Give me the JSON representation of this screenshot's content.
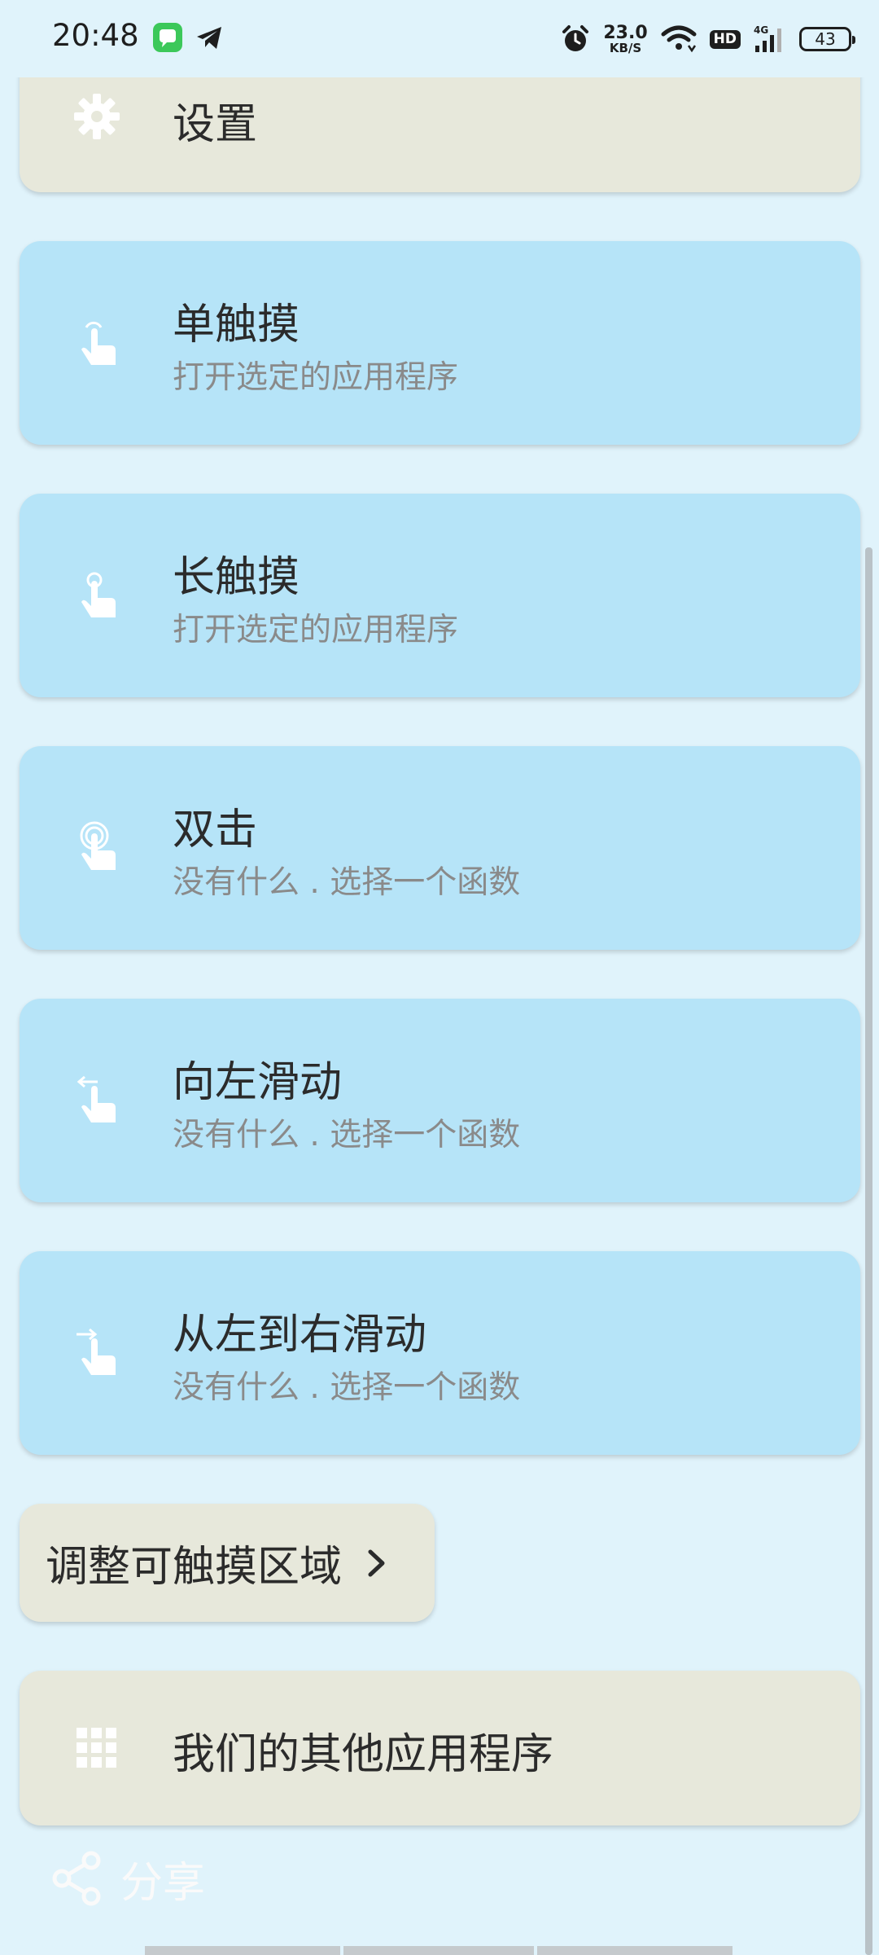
{
  "status_bar": {
    "time": "20:48",
    "net_speed_value": "23.0",
    "net_speed_unit": "KB/S",
    "hd_label": "HD",
    "network_type": "4G",
    "battery_level": "43"
  },
  "cards": {
    "settings": {
      "title": "设置",
      "icon": "gear-icon"
    },
    "single_touch": {
      "title": "单触摸",
      "subtitle": "打开选定的应用程序",
      "icon": "tap-gesture-icon"
    },
    "long_touch": {
      "title": "长触摸",
      "subtitle": "打开选定的应用程序",
      "icon": "long-press-gesture-icon"
    },
    "double_tap": {
      "title": "双击",
      "subtitle": "没有什么 . 选择一个函数",
      "icon": "double-tap-gesture-icon"
    },
    "swipe_left": {
      "title": "向左滑动",
      "subtitle": "没有什么 . 选择一个函数",
      "icon": "swipe-left-gesture-icon"
    },
    "swipe_right": {
      "title": "从左到右滑动",
      "subtitle": "没有什么 . 选择一个函数",
      "icon": "swipe-right-gesture-icon"
    },
    "other_apps": {
      "title": "我们的其他应用程序",
      "icon": "grid-apps-icon"
    }
  },
  "adjust_area": {
    "label": "调整可触摸区域"
  },
  "share": {
    "label": "分享"
  },
  "colors": {
    "background": "#e0f3fb",
    "card_blue": "#b6e4f8",
    "card_beige": "#e7e8db",
    "title_text": "#2b2b2b",
    "subtitle_text": "#8a8a8a"
  }
}
